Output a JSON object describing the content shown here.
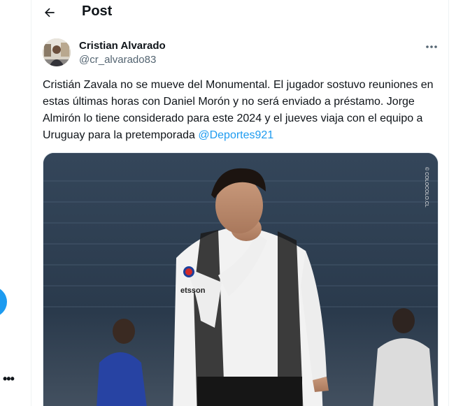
{
  "header": {
    "title": "Post",
    "back_icon": "back-arrow-icon"
  },
  "tweet": {
    "author_name": "Cristian Alvarado",
    "author_handle": "@cr_alvarado83",
    "text_before_mention": "Cristián Zavala no se mueve del Monumental. El jugador sostuvo reuniones en estas últimas horas con Daniel Morón y no será enviado a préstamo. Jorge Almirón lo tiene considerado para este  2024 y el jueves viaja con el equipo a Uruguay para la pretemporada ",
    "mention": "@Deportes921",
    "media_watermark": "© COLOCOLO.CL"
  },
  "left_rail": {
    "more_label": "•••"
  },
  "colors": {
    "accent": "#1d9bf0",
    "text_primary": "#0f1419",
    "text_secondary": "#536471"
  }
}
